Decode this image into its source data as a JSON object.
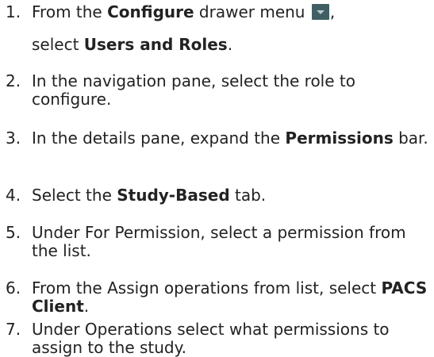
{
  "steps": [
    {
      "number": "1.",
      "before": "From the ",
      "bold": "Configure",
      "after": " drawer menu ",
      "icon": "drawer-menu-dropdown-icon",
      "after_icon": ",",
      "line2_before": "select ",
      "line2_bold": "Users and Roles",
      "line2_after": "."
    },
    {
      "number": "2.",
      "text": "In the navigation pane, select the role to configure."
    },
    {
      "number": "3.",
      "before": "In the details pane, expand the ",
      "bold": "Permissions",
      "after": " bar."
    },
    {
      "number": "4.",
      "before": "Select the ",
      "bold": "Study-Based",
      "after": " tab."
    },
    {
      "number": "5.",
      "text": "Under For Permission, select a permission from the list."
    },
    {
      "number": "6.",
      "before": "From the Assign operations from list, select ",
      "bold": "PACS Client",
      "after": "."
    },
    {
      "number": "7.",
      "text": "Under Operations select what permissions to assign to the study."
    }
  ],
  "colors": {
    "text": "#222222",
    "icon_bg": "#3f5f64",
    "icon_arrow": "#b9c9cc"
  }
}
